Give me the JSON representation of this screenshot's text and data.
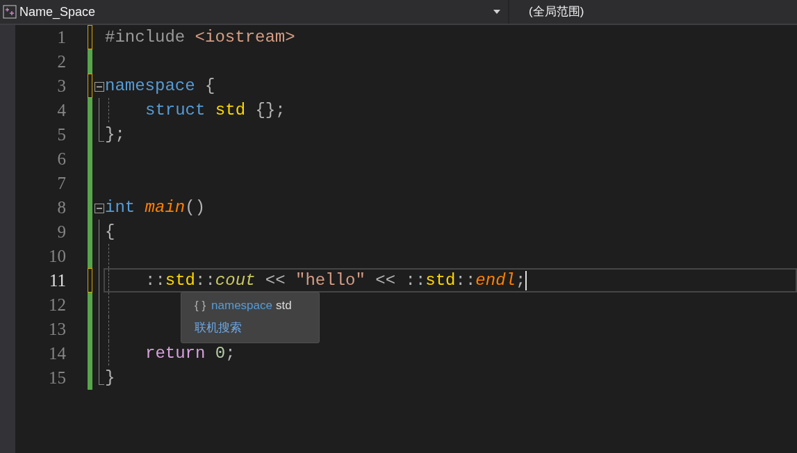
{
  "toolbar": {
    "project": "Name_Space",
    "scope": "(全局范围)"
  },
  "lines": [
    {
      "number": "1",
      "saved": false,
      "guide": false,
      "current": false,
      "indented": false,
      "tokens": [
        {
          "text": "#include",
          "kind": "preprocessor"
        },
        {
          "text": " <iostream>",
          "kind": "string"
        }
      ]
    },
    {
      "number": "2",
      "saved": true,
      "guide": false,
      "current": false
    },
    {
      "number": "3",
      "saved": false,
      "guide": false,
      "current": false,
      "indented": false,
      "expanded": true,
      "tokens": [
        {
          "text": "namespace",
          "kind": "keyword"
        },
        {
          "text": " {",
          "kind": "punct"
        }
      ],
      "children": [
        {
          "number": "4",
          "saved": true,
          "guide": true,
          "current": false,
          "indented": true,
          "tokens": [
            {
              "text": "struct",
              "kind": "keyword"
            },
            {
              "text": " std",
              "kind": "type"
            },
            {
              "text": " {};",
              "kind": "punct"
            }
          ]
        },
        {
          "number": "5",
          "saved": true,
          "guide": false,
          "current": false,
          "indented": false,
          "tokens": [
            {
              "text": "};",
              "kind": "punct"
            }
          ]
        }
      ]
    },
    {
      "number": "6",
      "saved": true,
      "guide": false,
      "current": false
    },
    {
      "number": "7",
      "saved": true,
      "guide": false,
      "current": false
    },
    {
      "number": "8",
      "saved": true,
      "guide": false,
      "current": false,
      "indented": false,
      "expanded": true,
      "tokens": [
        {
          "text": "int",
          "kind": "keyword"
        },
        {
          "text": " main",
          "kind": "function"
        },
        {
          "text": "()",
          "kind": "punct"
        }
      ],
      "children": [
        {
          "number": "9",
          "saved": true,
          "guide": false,
          "current": false,
          "indented": false,
          "tokens": [
            {
              "text": "{",
              "kind": "punct"
            }
          ]
        },
        {
          "number": "10",
          "saved": true,
          "guide": true,
          "current": false
        },
        {
          "number": "11",
          "saved": false,
          "guide": true,
          "current": true,
          "indented": true,
          "tokens": [
            {
              "text": "::",
              "kind": "punct"
            },
            {
              "text": "std",
              "kind": "type"
            },
            {
              "text": "::",
              "kind": "punct"
            },
            {
              "text": "cout",
              "kind": "variable"
            },
            {
              "text": " << ",
              "kind": "punct"
            },
            {
              "text": "\"hello\"",
              "kind": "string"
            },
            {
              "text": " << ::",
              "kind": "punct"
            },
            {
              "text": "std",
              "kind": "type"
            },
            {
              "text": "::",
              "kind": "punct"
            },
            {
              "text": "endl",
              "kind": "function"
            },
            {
              "text": ";",
              "kind": "punct"
            }
          ]
        },
        {
          "number": "12",
          "saved": true,
          "guide": true,
          "current": false
        },
        {
          "number": "13",
          "saved": true,
          "guide": true,
          "current": false
        },
        {
          "number": "14",
          "saved": true,
          "guide": true,
          "current": false,
          "indented": true,
          "tokens": [
            {
              "text": "return",
              "kind": "control"
            },
            {
              "text": " 0",
              "kind": "number"
            },
            {
              "text": ";",
              "kind": "punct"
            }
          ]
        },
        {
          "number": "15",
          "saved": true,
          "guide": false,
          "current": false,
          "indented": false,
          "tokens": [
            {
              "text": "}",
              "kind": "punct"
            }
          ]
        }
      ]
    }
  ],
  "tooltip": {
    "icon": "{ }",
    "keyword": "namespace",
    "name": "std",
    "link": "联机搜索"
  }
}
